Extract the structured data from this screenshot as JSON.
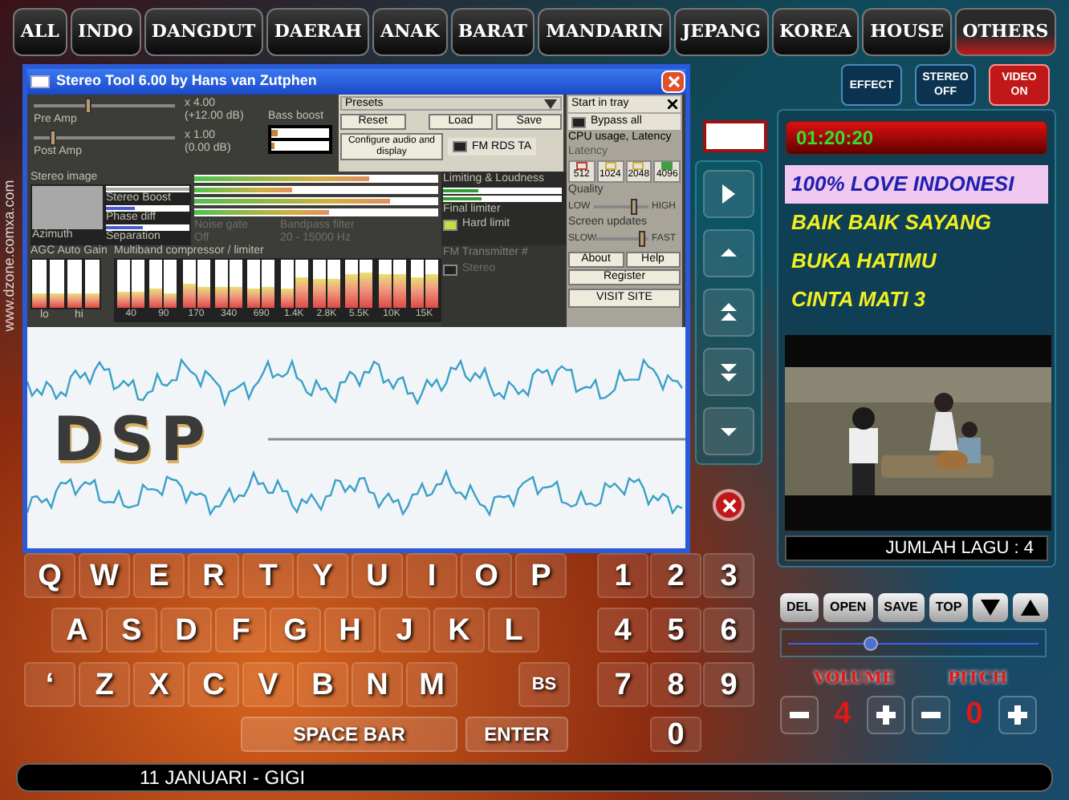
{
  "categories": [
    {
      "label": "ALL",
      "selected": false
    },
    {
      "label": "INDO",
      "selected": false
    },
    {
      "label": "DANGDUT",
      "selected": false
    },
    {
      "label": "DAERAH",
      "selected": false
    },
    {
      "label": "ANAK",
      "selected": false
    },
    {
      "label": "BARAT",
      "selected": false
    },
    {
      "label": "MANDARIN",
      "selected": false
    },
    {
      "label": "JEPANG",
      "selected": false
    },
    {
      "label": "KOREA",
      "selected": false
    },
    {
      "label": "HOUSE",
      "selected": false
    },
    {
      "label": "OTHERS",
      "selected": true
    }
  ],
  "stereo_tool": {
    "title": "Stereo Tool 6.00 by Hans van Zutphen",
    "amps": [
      {
        "name": "Pre Amp",
        "factor": "x 4.00",
        "db": "(+12.00 dB)",
        "level": 0.38
      },
      {
        "name": "Post Amp",
        "factor": "x 1.00",
        "db": "(0.00 dB)",
        "level": 0.12
      }
    ],
    "bass_boost": {
      "label": "Bass boost",
      "bars": [
        {
          "level": 0.1
        },
        {
          "level": 0.05
        }
      ]
    },
    "presets": {
      "label": "Presets",
      "buttons": [
        "Reset",
        "Load",
        "Save"
      ],
      "configure": "Configure audio and display",
      "fm_rds": {
        "label": "FM RDS TA",
        "checked": false
      }
    },
    "stereo_image": {
      "label": "Stereo image",
      "azimuth": "Azimuth",
      "bars": [
        {
          "name": "Stereo Boost",
          "level": 1
        },
        {
          "name": "Phase diff",
          "level": 0.35
        },
        {
          "name": "Separation",
          "level": 0.45
        }
      ]
    },
    "meters": [
      {
        "level": 0.72
      },
      {
        "level": 0.4
      },
      {
        "level": 0.8
      },
      {
        "level": 0.55
      }
    ],
    "noise_gate": {
      "label": "Noise gate",
      "value": "Off"
    },
    "bandpass": {
      "label": "Bandpass filter",
      "value": "20 - 15000 Hz"
    },
    "limiting": {
      "label": "Limiting & Loudness",
      "meters": [
        {
          "level": 0.3
        },
        {
          "level": 0.32
        }
      ],
      "final": "Final limiter",
      "hard_limit": {
        "label": "Hard limit",
        "checked": true
      }
    },
    "agc": {
      "label": "AGC Auto Gain",
      "bars": [
        {
          "level": 0.3
        },
        {
          "level": 0.3
        },
        {
          "level": 0.3
        },
        {
          "level": 0.3
        }
      ],
      "low": "lo",
      "high": "hi"
    },
    "multiband": {
      "label": "Multiband compressor / limiter",
      "bands": [
        {
          "label": "40",
          "bars": [
            {
              "level": 0.35
            },
            {
              "level": 0.35
            }
          ]
        },
        {
          "label": "90",
          "bars": [
            {
              "level": 0.4
            },
            {
              "level": 0.3
            }
          ]
        },
        {
          "label": "170",
          "bars": [
            {
              "level": 0.5
            },
            {
              "level": 0.45
            }
          ]
        },
        {
          "label": "340",
          "bars": [
            {
              "level": 0.45
            },
            {
              "level": 0.45
            }
          ]
        },
        {
          "label": "690",
          "bars": [
            {
              "level": 0.4
            },
            {
              "level": 0.45
            }
          ]
        },
        {
          "label": "1.4K",
          "bars": [
            {
              "level": 0.4
            },
            {
              "level": 0.65
            }
          ]
        },
        {
          "label": "2.8K",
          "bars": [
            {
              "level": 0.6
            },
            {
              "level": 0.6
            }
          ]
        },
        {
          "label": "5.5K",
          "bars": [
            {
              "level": 0.7
            },
            {
              "level": 0.75
            }
          ]
        },
        {
          "label": "10K",
          "bars": [
            {
              "level": 0.7
            },
            {
              "level": 0.7
            }
          ]
        },
        {
          "label": "15K",
          "bars": [
            {
              "level": 0.65
            },
            {
              "level": 0.7
            }
          ]
        }
      ]
    },
    "fm": {
      "label": "FM Transmitter #",
      "stereo": {
        "label": "Stereo",
        "checked": false
      }
    },
    "sidebar": {
      "tray": "Start in tray",
      "bypass": {
        "label": "Bypass all",
        "checked": false
      },
      "cpu": "CPU usage, Latency",
      "latency_label": "Latency",
      "latency": [
        {
          "label": "512",
          "color": "#c04040",
          "selected": false
        },
        {
          "label": "1024",
          "color": "#d0b040",
          "selected": false
        },
        {
          "label": "2048",
          "color": "#d0b040",
          "selected": false
        },
        {
          "label": "4096",
          "color": "#40a040",
          "selected": true
        }
      ],
      "quality": {
        "label": "Quality",
        "low": "LOW",
        "high": "HIGH",
        "level": 0.75
      },
      "updates": {
        "label": "Screen updates",
        "low": "SLOW",
        "high": "FAST",
        "level": 0.92
      },
      "buttons": [
        "About",
        "Help",
        "Register",
        "VISIT SITE"
      ]
    },
    "logo": "DSP"
  },
  "mode_buttons": [
    {
      "lines": [
        "EFFECT"
      ],
      "on": false
    },
    {
      "lines": [
        "STEREO",
        "OFF"
      ],
      "on": false
    },
    {
      "lines": [
        "VIDEO",
        "ON"
      ],
      "on": true
    }
  ],
  "side_url": "www.dzone.comxa.com",
  "nav_buttons": [
    {
      "kind": "play"
    },
    {
      "kind": "up"
    },
    {
      "kind": "page-up"
    },
    {
      "kind": "page-down"
    },
    {
      "kind": "down"
    }
  ],
  "player": {
    "time": "01:20:20",
    "playlist": [
      {
        "title": "100% LOVE INDONESI",
        "selected": true
      },
      {
        "title": "BAIK BAIK SAYANG",
        "selected": false
      },
      {
        "title": "BUKA HATIMU",
        "selected": false
      },
      {
        "title": "CINTA MATI 3",
        "selected": false
      }
    ],
    "count": "JUMLAH LAGU : 4"
  },
  "list_buttons": [
    {
      "kind": "text",
      "label": "DEL"
    },
    {
      "kind": "text",
      "label": "OPEN"
    },
    {
      "kind": "text",
      "label": "SAVE"
    },
    {
      "kind": "text",
      "label": "TOP"
    },
    {
      "kind": "down"
    },
    {
      "kind": "up"
    }
  ],
  "seek": {
    "level": 0.33
  },
  "volume": {
    "label": "VOLUME",
    "value": "4"
  },
  "pitch": {
    "label": "PITCH",
    "value": "0"
  },
  "keyboard": {
    "rows": [
      [
        "Q",
        "W",
        "E",
        "R",
        "T",
        "Y",
        "U",
        "I",
        "O",
        "P"
      ],
      [
        "A",
        "S",
        "D",
        "F",
        "G",
        "H",
        "J",
        "K",
        "L"
      ],
      [
        "‘",
        "Z",
        "X",
        "C",
        "V",
        "B",
        "N",
        "M"
      ]
    ],
    "backspace": "BS",
    "space": "SPACE BAR",
    "enter": "ENTER"
  },
  "numpad": [
    [
      "1",
      "2",
      "3"
    ],
    [
      "4",
      "5",
      "6"
    ],
    [
      "7",
      "8",
      "9"
    ],
    [
      "0"
    ]
  ],
  "now_playing": "11 JANUARI - GIGI"
}
